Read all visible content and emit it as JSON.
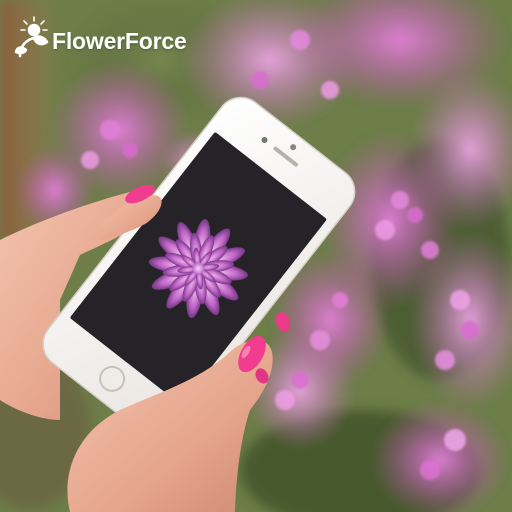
{
  "logo": {
    "text": "FlowerForce",
    "icon": "flower-sprout-icon",
    "color": "#ffffff"
  },
  "photo": {
    "subject": "hands-holding-phone-over-hyacinths",
    "flower_color": "#d660c8",
    "phone_wallpaper_color": "#b05ab4"
  }
}
